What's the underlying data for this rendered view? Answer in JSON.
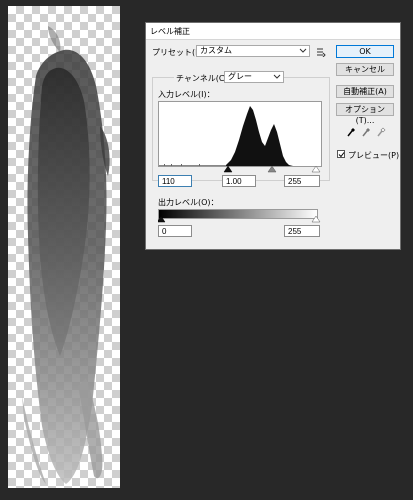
{
  "dialog": {
    "title": "レベル補正",
    "preset_label": "プリセット(E)：",
    "preset_value": "カスタム",
    "channel_label": "チャンネル(C)：",
    "channel_value": "グレー",
    "input_levels_label": "入力レベル(I)：",
    "input_black": "110",
    "input_gamma": "1.00",
    "input_white": "255",
    "output_levels_label": "出力レベル(O)：",
    "output_black": "0",
    "output_white": "255",
    "buttons": {
      "ok": "OK",
      "cancel": "キャンセル",
      "auto": "自動補正(A)",
      "options": "オプション(T)..."
    },
    "preview_label": "プレビュー(P)",
    "preview_checked": true
  },
  "icons": {
    "preset_menu": "preset-options-icon",
    "black_eyedropper": "black-eyedropper-icon",
    "gray_eyedropper": "gray-eyedropper-icon",
    "white_eyedropper": "white-eyedropper-icon"
  },
  "colors": {
    "app_background": "#282828",
    "dialog_background": "#efefef",
    "primary_button_border": "#0078d7"
  }
}
